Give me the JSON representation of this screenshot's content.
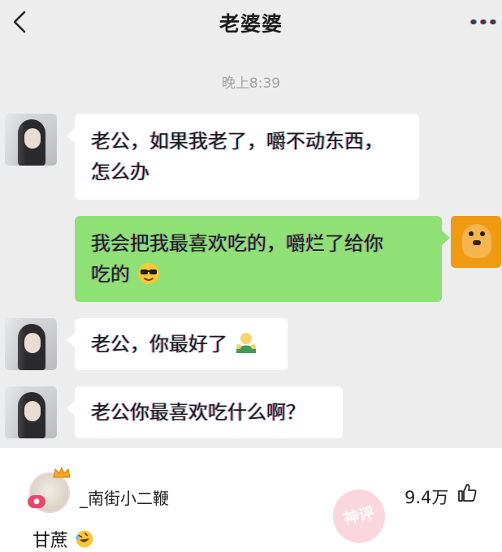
{
  "header": {
    "title": "老婆婆",
    "back_icon": "back-chevron-icon",
    "more_icon": "more-dots-icon"
  },
  "chat": {
    "timestamp": "晚上8:39",
    "messages": [
      {
        "sender": "wife",
        "lines": [
          "老公，如果我老了，嚼不动东西，",
          "怎么办"
        ]
      },
      {
        "sender": "me",
        "lines": [
          "我会把我最喜欢吃的，嚼烂了给你",
          "吃的"
        ],
        "emoji": "cool-sunglasses-emoji"
      },
      {
        "sender": "wife",
        "text": "老公，你最好了",
        "emoji": "hug-emoji"
      },
      {
        "sender": "wife",
        "text": "老公你最喜欢吃什么啊？"
      }
    ]
  },
  "comment": {
    "username": "_南街小二鞭",
    "likes": "9.4万",
    "like_icon": "thumbs-up-icon",
    "text": "甘蔗",
    "text_emoji": "rolling-laughing-emoji",
    "stamp_text": "神评"
  },
  "colors": {
    "chat_bg": "#ededed",
    "green_bubble": "#8fe075",
    "white_bubble": "#ffffff"
  }
}
